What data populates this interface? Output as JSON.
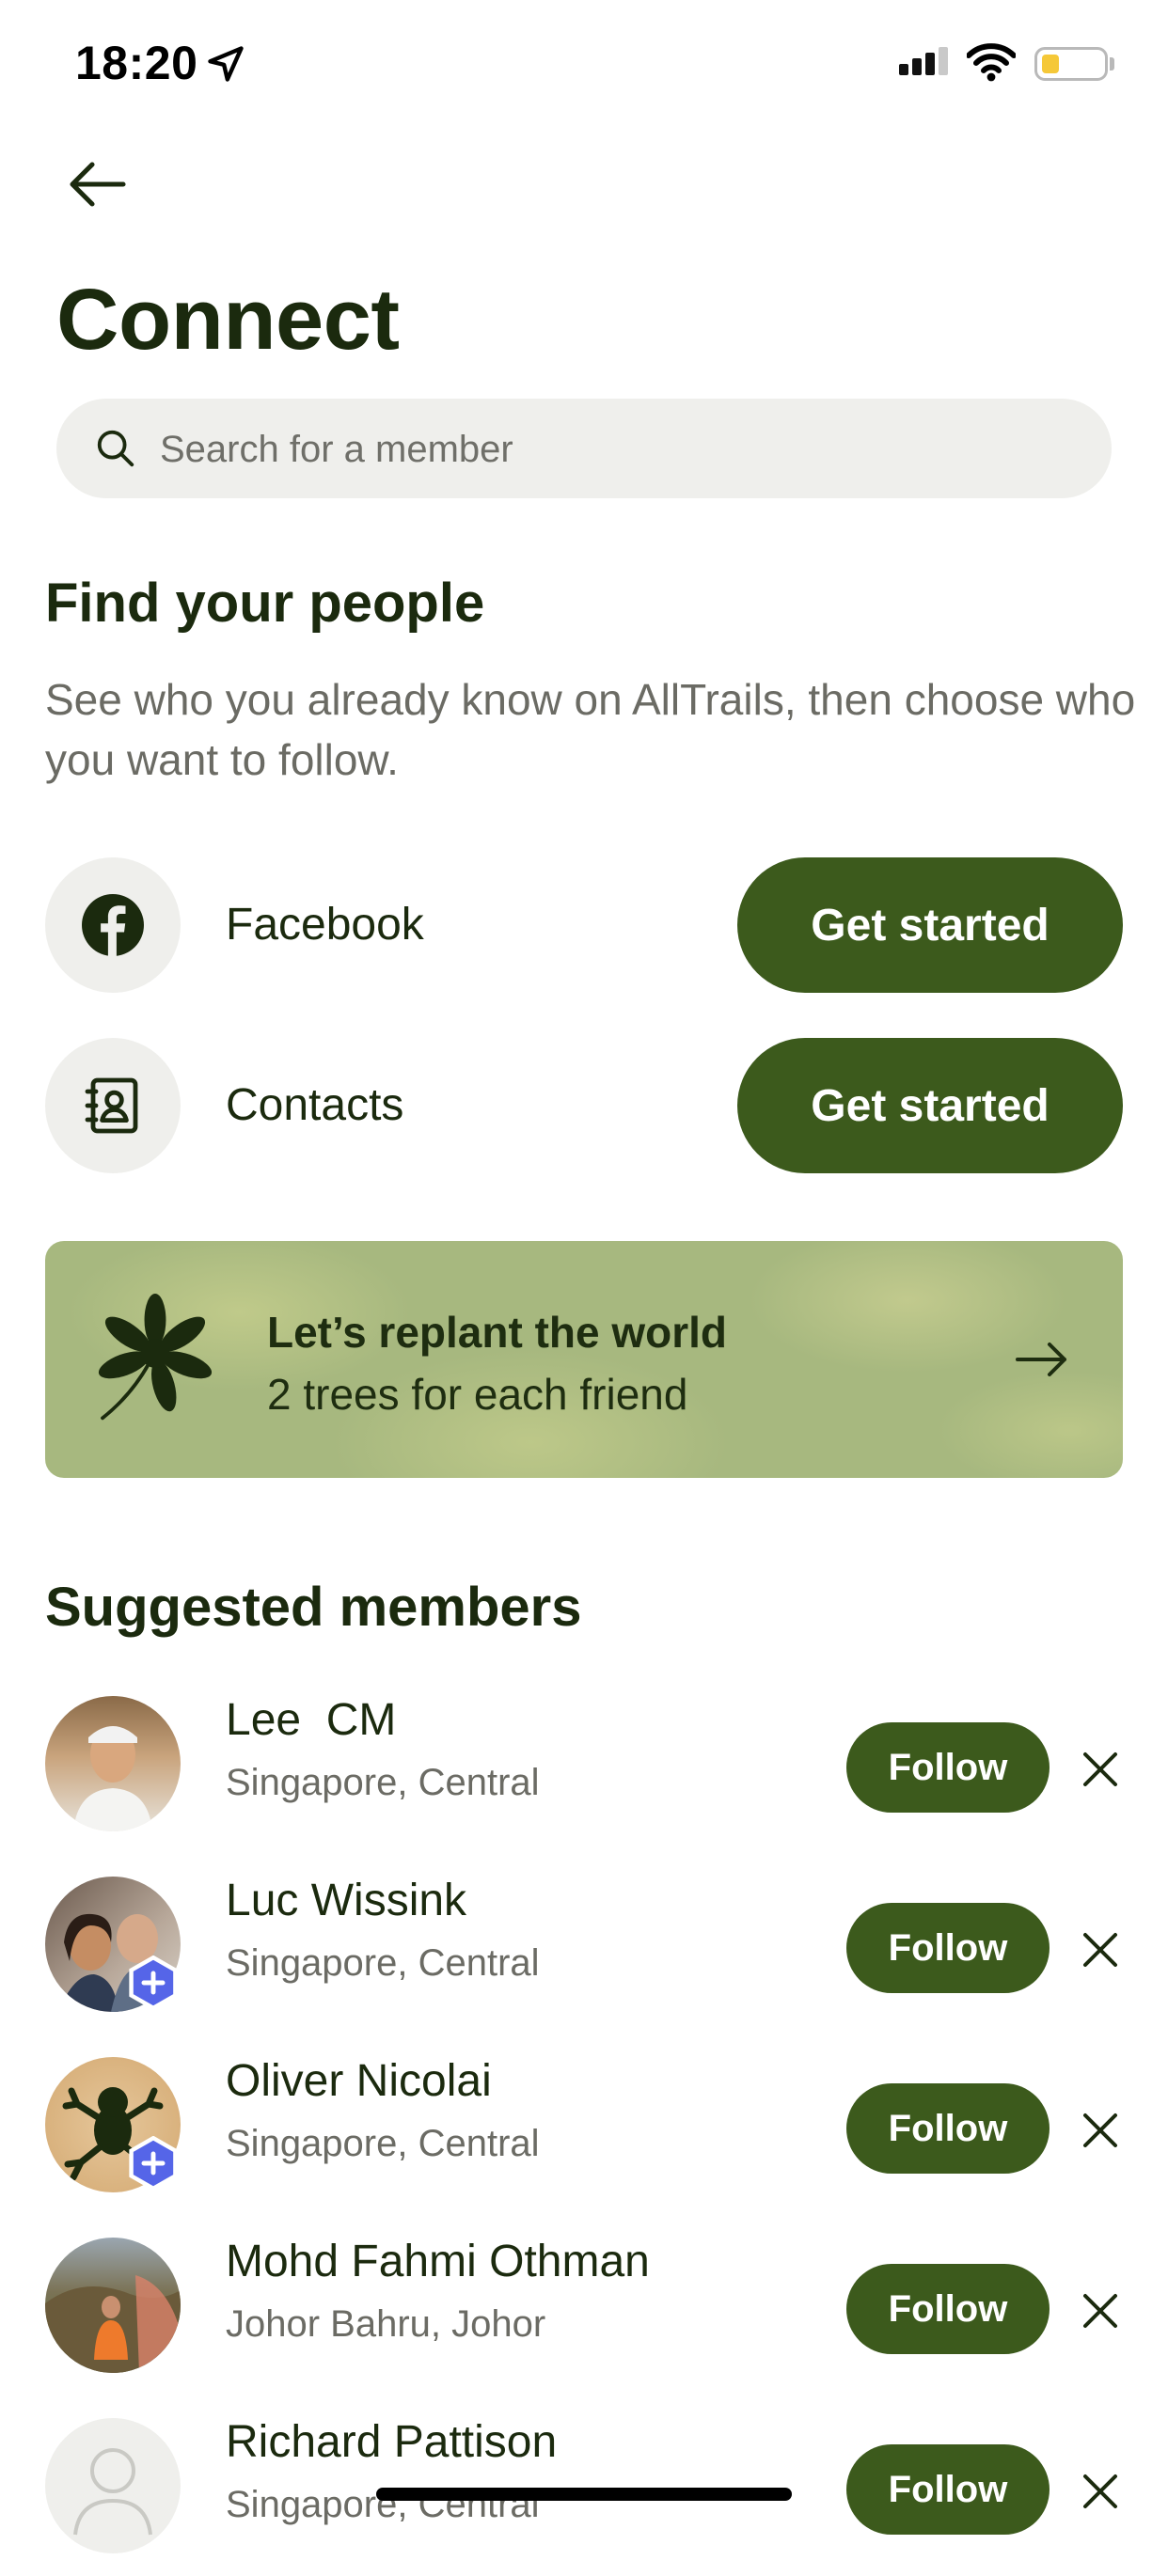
{
  "status_bar": {
    "time": "18:20"
  },
  "header": {
    "title": "Connect"
  },
  "search": {
    "placeholder": "Search for a member"
  },
  "find_people": {
    "title": "Find your people",
    "description": "See who you already know on AllTrails, then choose who you want to follow.",
    "rows": [
      {
        "label": "Facebook",
        "icon": "facebook-icon",
        "button": "Get started"
      },
      {
        "label": "Contacts",
        "icon": "contacts-book-icon",
        "button": "Get started"
      }
    ]
  },
  "banner": {
    "title": "Let’s replant the world",
    "subtitle": "2 trees for each friend",
    "icon": "leaf-icon",
    "colors": {
      "background": "#a7b87f",
      "text": "#1e2d10"
    }
  },
  "suggested": {
    "title": "Suggested members",
    "follow_label": "Follow",
    "members": [
      {
        "name": "Lee  CM",
        "location": "Singapore, Central",
        "plus": false
      },
      {
        "name": "Luc Wissink",
        "location": "Singapore, Central",
        "plus": true
      },
      {
        "name": "Oliver Nicolai",
        "location": "Singapore, Central",
        "plus": true
      },
      {
        "name": "Mohd Fahmi Othman",
        "location": "Johor Bahru, Johor",
        "plus": false
      },
      {
        "name": "Richard Pattison",
        "location": "Singapore, Central",
        "plus": false
      }
    ]
  },
  "colors": {
    "accent": "#3c5a1c",
    "title_text": "#1b2a0e",
    "secondary_text": "#6b6b64",
    "surface": "#efefec",
    "plus_badge": "#5565e8"
  }
}
